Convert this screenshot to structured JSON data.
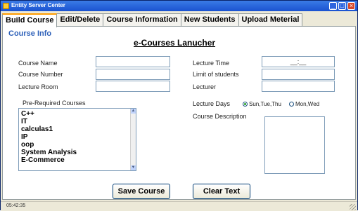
{
  "window": {
    "title": "Entity Server Center"
  },
  "tabs": [
    "Build Course",
    "Edit/Delete",
    "Course Information",
    "New Students",
    "Upload Meterial"
  ],
  "form": {
    "section_title": "Course Info",
    "main_title": "e-Courses Lanucher",
    "course_name_label": "Course Name",
    "course_number_label": "Course Number",
    "lecture_room_label": "Lecture Room",
    "lecture_time_label": "Lecture Time",
    "lecture_time_value": "__:__",
    "limit_label": "Limit of students",
    "lecturer_label": "Lecturer",
    "prereq_label": "Pre-Required Courses",
    "prereq_items": [
      "C++",
      "IT",
      "calculas1",
      "IP",
      "oop",
      "System Analysis",
      "E-Commerce"
    ],
    "lecture_days_label": "Lecture Days",
    "day_option_1": "Sun,Tue,Thu",
    "day_option_2": "Mon,Wed",
    "course_desc_label": "Course Description",
    "save_button": "Save Course",
    "clear_button": "Clear Text"
  },
  "status": {
    "time": "05:42:35"
  },
  "colors": {
    "titlebar": "#1a52d0",
    "tab_highlight": "#ff9c00",
    "section_title": "#2c5fb8"
  }
}
